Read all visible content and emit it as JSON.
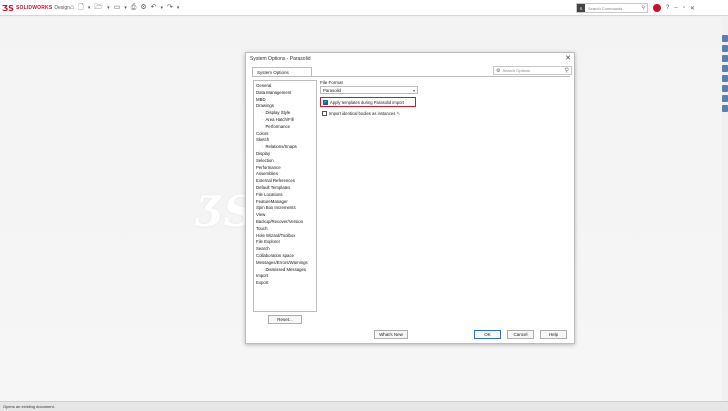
{
  "app": {
    "brand": "SOLIDWORKS",
    "brand_sub": "Design",
    "logo_glyph": "ƷS",
    "accent": "#c8102e"
  },
  "toolbar": {
    "search_tag": "S",
    "search_placeholder": "Search Commands",
    "icons": [
      "home-icon",
      "new-document-icon",
      "open-folder-icon",
      "save-icon",
      "print-icon",
      "undo-icon",
      "redo-icon",
      "options-gear-icon",
      "avatar",
      "help-icon",
      "minimize-icon",
      "close-icon"
    ]
  },
  "status": {
    "text": "Opens an existing document."
  },
  "dialog": {
    "title": "System Options - Parasolid",
    "tab_label": "System Options",
    "search_placeholder": "Search Options",
    "tree": [
      {
        "label": "General",
        "level": 1
      },
      {
        "label": "Data Management",
        "level": 1
      },
      {
        "label": "MBD",
        "level": 1
      },
      {
        "label": "Drawings",
        "level": 1
      },
      {
        "label": "Display Style",
        "level": 2
      },
      {
        "label": "Area Hatch/Fill",
        "level": 2
      },
      {
        "label": "Performance",
        "level": 2
      },
      {
        "label": "Colors",
        "level": 1
      },
      {
        "label": "Sketch",
        "level": 1
      },
      {
        "label": "Relations/Snaps",
        "level": 2
      },
      {
        "label": "Display",
        "level": 1
      },
      {
        "label": "Selection",
        "level": 1
      },
      {
        "label": "Performance",
        "level": 1
      },
      {
        "label": "Assemblies",
        "level": 1
      },
      {
        "label": "External References",
        "level": 1
      },
      {
        "label": "Default Templates",
        "level": 1
      },
      {
        "label": "File Locations",
        "level": 1
      },
      {
        "label": "FeatureManager",
        "level": 1
      },
      {
        "label": "Spin Box Increments",
        "level": 1
      },
      {
        "label": "View",
        "level": 1
      },
      {
        "label": "Backup/Recover/Version",
        "level": 1
      },
      {
        "label": "Touch",
        "level": 1
      },
      {
        "label": "Hole Wizard/Toolbox",
        "level": 1
      },
      {
        "label": "File Explorer",
        "level": 1
      },
      {
        "label": "Search",
        "level": 1
      },
      {
        "label": "Collaboration space",
        "level": 1
      },
      {
        "label": "Messages/Errors/Warnings",
        "level": 1
      },
      {
        "label": "Dismissed Messages",
        "level": 2
      },
      {
        "label": "Import",
        "level": 1
      },
      {
        "label": "Export",
        "level": 1
      }
    ],
    "file_format_label": "File Format",
    "file_format_value": "Parasolid",
    "options": {
      "apply_templates_label": "Apply templates during Parasolid import",
      "apply_templates_checked": true,
      "import_identical_label": "Import identical bodies as instances"
    },
    "buttons": {
      "reset": "Reset...",
      "whats_new": "What's New",
      "ok": "OK",
      "cancel": "Cancel",
      "help": "Help"
    },
    "highlight_color": "#d4182b"
  }
}
